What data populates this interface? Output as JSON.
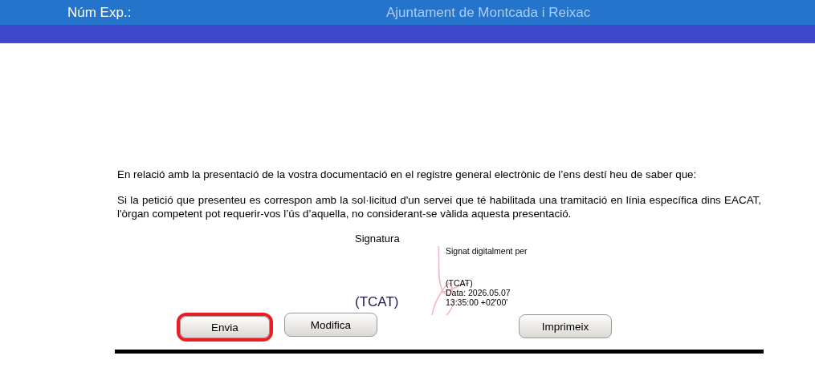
{
  "header": {
    "exp_label": "Núm Exp.:",
    "title": "Ajuntament de Montcada i Reixac"
  },
  "paragraphs": [
    "En relació amb la presentació de la vostra documentació en el registre general electrònic de l’ens destí heu de saber que:",
    "Si la petició que presenteu es correspon amb la sol·licitud d'un servei que té habilitada una tramitació en línia específica dins EACAT, l'òrgan competent pot requerir-vos l’ús d’aquella, no considerant-se vàlida aquesta presentació."
  ],
  "signature": {
    "label": "Signatura",
    "name": "(TCAT)",
    "stamp_heading": "Signat digitalment per",
    "stamp_lines": [
      "(TCAT)",
      "Data: 2026.05.07",
      "13:35:00 +02'00'"
    ]
  },
  "buttons": [
    {
      "label": "Envia",
      "selected": true
    },
    {
      "label": "Modifica",
      "selected": false
    },
    {
      "label": "Imprimeix",
      "selected": false
    }
  ]
}
